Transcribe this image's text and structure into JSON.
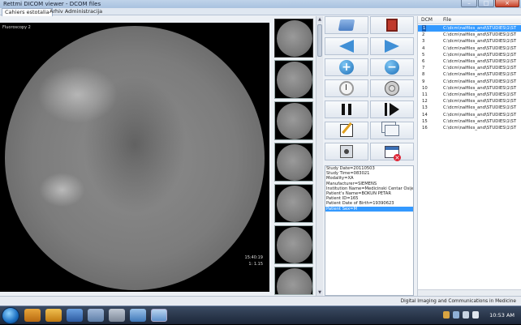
{
  "window": {
    "title": "Rettmi DICOM viewer - DCOM files",
    "controls": {
      "minimize": "–",
      "maximize": "□",
      "close": "×"
    }
  },
  "tabs": [
    {
      "label": "Cahiers estotalia",
      "active": true
    },
    {
      "label": "Arhiv Administracija",
      "active": false
    }
  ],
  "viewer": {
    "series_label": "Fluoroscopy 2",
    "frame_info": [
      "15:40:19",
      "1: 1.15"
    ]
  },
  "scroll": {
    "up": "▲",
    "down": "▼"
  },
  "info_panel": {
    "lines": [
      {
        "text": "Study Date=20110503",
        "highlight": false
      },
      {
        "text": "Study Time=083021",
        "highlight": false
      },
      {
        "text": "Modality=XA",
        "highlight": false
      },
      {
        "text": "Manufacturer=SIEMENS",
        "highlight": false
      },
      {
        "text": "Institution Name=Medicinski Centar Osijek",
        "highlight": false
      },
      {
        "text": "Patient's Name=BOKUN PETAR",
        "highlight": false
      },
      {
        "text": "Patient ID=165",
        "highlight": false
      },
      {
        "text": "Patient Date of Birth=19390623",
        "highlight": false
      },
      {
        "text": "Patient Sex=M",
        "highlight": true
      }
    ]
  },
  "file_list": {
    "col_dcm": "DCM",
    "col_file": "File",
    "rows": [
      {
        "n": "1",
        "path": "C:\\dcm\\nalfiles_and\\STUDIES\\1\\ST",
        "selected": true
      },
      {
        "n": "2",
        "path": "C:\\dcm\\nalfiles_and\\STUDIES\\1\\ST",
        "selected": false
      },
      {
        "n": "3",
        "path": "C:\\dcm\\nalfiles_and\\STUDIES\\1\\ST",
        "selected": false
      },
      {
        "n": "4",
        "path": "C:\\dcm\\nalfiles_and\\STUDIES\\1\\ST",
        "selected": false
      },
      {
        "n": "5",
        "path": "C:\\dcm\\nalfiles_and\\STUDIES\\1\\ST",
        "selected": false
      },
      {
        "n": "6",
        "path": "C:\\dcm\\nalfiles_and\\STUDIES\\1\\ST",
        "selected": false
      },
      {
        "n": "7",
        "path": "C:\\dcm\\nalfiles_and\\STUDIES\\1\\ST",
        "selected": false
      },
      {
        "n": "8",
        "path": "C:\\dcm\\nalfiles_and\\STUDIES\\1\\ST",
        "selected": false
      },
      {
        "n": "9",
        "path": "C:\\dcm\\nalfiles_and\\STUDIES\\1\\ST",
        "selected": false
      },
      {
        "n": "10",
        "path": "C:\\dcm\\nalfiles_and\\STUDIES\\1\\ST",
        "selected": false
      },
      {
        "n": "11",
        "path": "C:\\dcm\\nalfiles_and\\STUDIES\\1\\ST",
        "selected": false
      },
      {
        "n": "12",
        "path": "C:\\dcm\\nalfiles_and\\STUDIES\\1\\ST",
        "selected": false
      },
      {
        "n": "13",
        "path": "C:\\dcm\\nalfiles_and\\STUDIES\\1\\ST",
        "selected": false
      },
      {
        "n": "14",
        "path": "C:\\dcm\\nalfiles_and\\STUDIES\\1\\ST",
        "selected": false
      },
      {
        "n": "15",
        "path": "C:\\dcm\\nalfiles_and\\STUDIES\\1\\ST",
        "selected": false
      },
      {
        "n": "16",
        "path": "C:\\dcm\\nalfiles_and\\STUDIES\\1\\ST",
        "selected": false
      }
    ]
  },
  "status_bar": {
    "message": "Digital Imaging and Communications in Medicine"
  },
  "taskbar": {
    "clock": "10:53 AM"
  },
  "icons": {
    "toolbar": [
      "open-folder-icon",
      "exit-door-icon",
      "arrow-left-icon",
      "arrow-right-icon",
      "zoom-in-icon",
      "zoom-out-icon",
      "clock-icon",
      "film-reel-icon",
      "pause-icon",
      "step-forward-icon",
      "edit-icon",
      "copy-icon",
      "disc-icon",
      "close-window-icon"
    ]
  },
  "colors": {
    "selection": "#3399ff",
    "accent_blue": "#3f8fd6",
    "exit_red": "#c0392b"
  }
}
